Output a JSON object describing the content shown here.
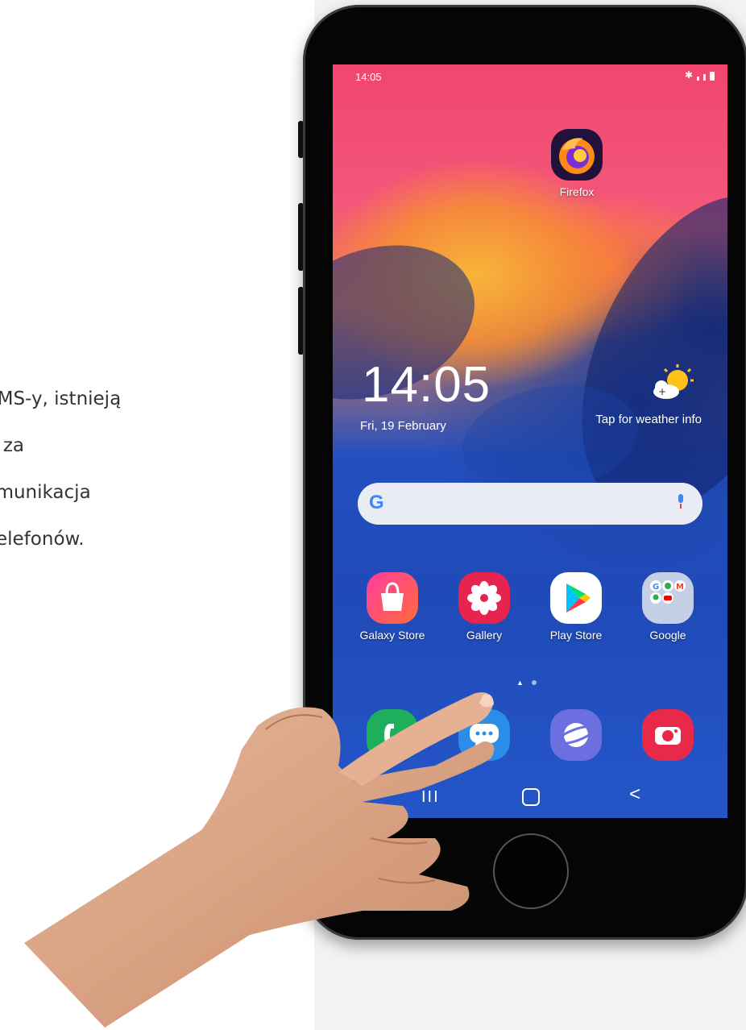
{
  "slide_text": {
    "lines": [
      "SMS-y, istnieją",
      "się za",
      "komunikacja",
      "telefonów."
    ]
  },
  "status_bar": {
    "time": "14:05",
    "signal_icon": "signal-icon",
    "battery_icon": "battery-icon"
  },
  "top_app": {
    "label": "Firefox",
    "icon": "firefox-icon"
  },
  "clock_widget": {
    "time": "14:05",
    "date": "Fri, 19 February"
  },
  "weather_widget": {
    "label": "Tap for weather info",
    "icon": "weather-sun-cloud-icon"
  },
  "search_bar": {
    "logo": "G",
    "mic_icon": "mic-icon"
  },
  "apps": [
    {
      "label": "Galaxy Store",
      "icon": "shopping-bag-icon"
    },
    {
      "label": "Gallery",
      "icon": "flower-icon"
    },
    {
      "label": "Play Store",
      "icon": "play-store-icon"
    },
    {
      "label": "Google",
      "icon": "google-folder-icon"
    }
  ],
  "dock": [
    {
      "name": "phone",
      "icon": "phone-icon",
      "color": "#1fae5b"
    },
    {
      "name": "messages",
      "icon": "chat-bubble-icon",
      "color": "#2a8ee8"
    },
    {
      "name": "internet",
      "icon": "planet-icon",
      "color": "#6b6fe0"
    },
    {
      "name": "camera",
      "icon": "camera-icon",
      "color": "#e8294a"
    }
  ],
  "nav_bar": {
    "recents": "III",
    "back": "<"
  }
}
